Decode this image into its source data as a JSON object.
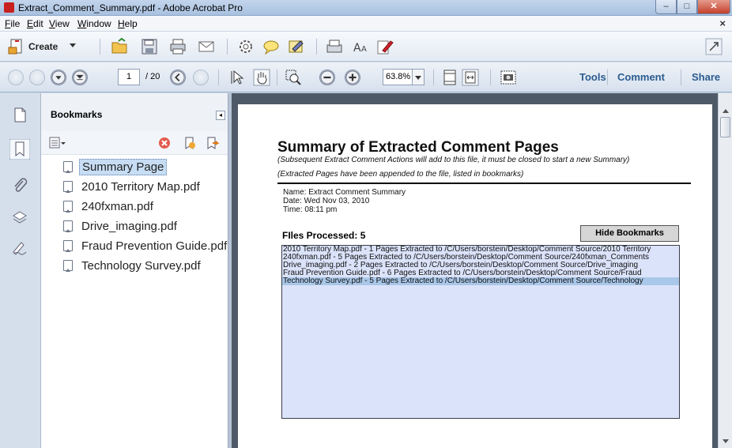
{
  "window": {
    "title": "Extract_Comment_Summary.pdf - Adobe Acrobat Pro",
    "controls": {
      "minimize": "–",
      "maximize": "□",
      "close": "✕"
    }
  },
  "menubar": {
    "items": [
      "File",
      "Edit",
      "View",
      "Window",
      "Help"
    ],
    "close_doc": "×"
  },
  "toolbar": {
    "create_label": "Create",
    "icons": [
      "create-pdf-icon",
      "open-folder-icon",
      "save-icon",
      "print-icon",
      "email-icon",
      "settings-icon",
      "comment-icon",
      "sign-icon",
      "scanner-icon",
      "text-size-icon",
      "edit-pen-icon",
      "expand-icon"
    ]
  },
  "navbar": {
    "page_current": "1",
    "page_total": "/ 20",
    "zoom": "63.8%",
    "links": {
      "tools": "Tools",
      "comment": "Comment",
      "share": "Share"
    }
  },
  "bookmarks": {
    "title": "Bookmarks",
    "items": [
      {
        "label": "Summary Page",
        "selected": true
      },
      {
        "label": "2010 Territory Map.pdf",
        "selected": false
      },
      {
        "label": "240fxman.pdf",
        "selected": false
      },
      {
        "label": "Drive_imaging.pdf",
        "selected": false
      },
      {
        "label": "Fraud Prevention Guide.pdf",
        "selected": false
      },
      {
        "label": "Technology Survey.pdf",
        "selected": false
      }
    ]
  },
  "document": {
    "title": "Summary of Extracted Comment Pages",
    "subtitle1": "(Subsequent Extract Comment Actions will add to this file, it must be closed to start a new Summary)",
    "subtitle2": "(Extracted Pages have been appended to the file, listed in bookmarks)",
    "name_line": "Name: Extract Comment Summary",
    "date_line": "Date: Wed Nov 03, 2010",
    "time_line": "Time: 08:11 pm",
    "files_processed_label": "FIles Processed: 5",
    "hide_button": "Hide Bookmarks",
    "files": [
      "2010 Territory Map.pdf - 1 Pages Extracted to /C/Users/borstein/Desktop/Comment Source/2010 Territory",
      "240fxman.pdf - 5 Pages Extracted to /C/Users/borstein/Desktop/Comment Source/240fxman_Comments",
      "Drive_imaging.pdf - 2 Pages Extracted to /C/Users/borstein/Desktop/Comment Source/Drive_imaging",
      "Fraud Prevention Guide.pdf - 6 Pages Extracted to /C/Users/borstein/Desktop/Comment Source/Fraud",
      "Technology Survey.pdf - 5 Pages Extracted to /C/Users/borstein/Desktop/Comment Source/Technology"
    ]
  }
}
